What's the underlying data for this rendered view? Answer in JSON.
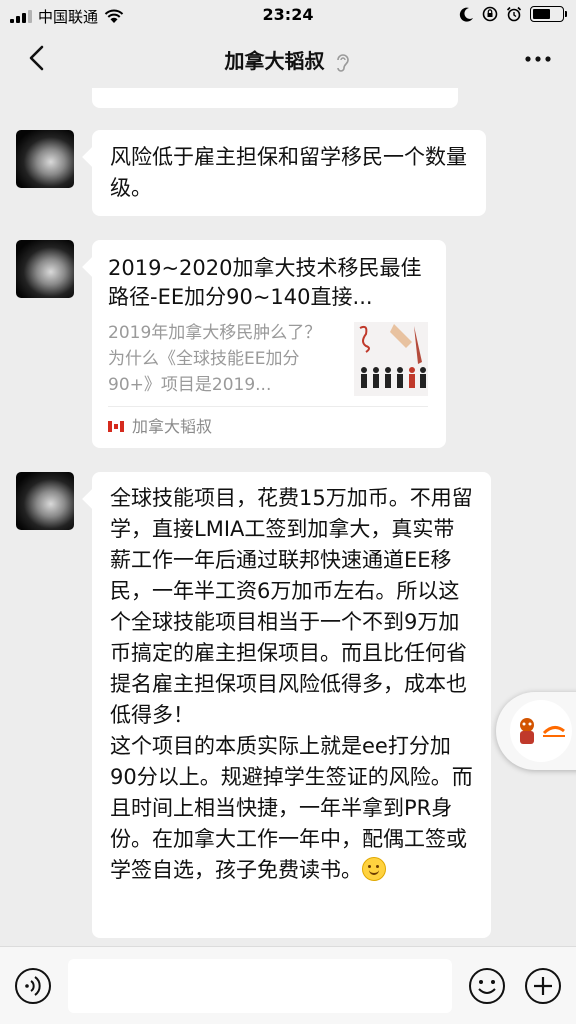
{
  "status_bar": {
    "carrier": "中国联通",
    "time": "23:24"
  },
  "nav": {
    "title": "加拿大韬叔",
    "back_icon": "chevron-left-icon",
    "ear_icon": "ear-icon",
    "more_icon": "more-dots-icon"
  },
  "messages": [
    {
      "type": "text",
      "text": "风险低于雇主担保和留学移民一个数量级。"
    },
    {
      "type": "link_card",
      "title": "2019~2020加拿大技术移民最佳路径-EE加分90~140直接...",
      "description": "2019年加拿大移民肿么了？为什么《全球技能EE加分90+》项目是2019...",
      "source": "加拿大韬叔",
      "source_icon": "canada-flag-icon"
    },
    {
      "type": "text",
      "text": "全球技能项目，花费15万加币。不用留学，直接LMIA工签到加拿大，真实带薪工作一年后通过联邦快速通道EE移民，一年半工资6万加币左右。所以这个全球技能项目相当于一个不到9万加币搞定的雇主担保项目。而且比任何省提名雇主担保项目风险低得多，成本也低得多！\n这个项目的本质实际上就是ee打分加90分以上。规避掉学生签证的风险。而且时间上相当快捷，一年半拿到PR身份。在加拿大工作一年中，配偶工签或学签自选，孩子免费读书。",
      "trailing_emoji": "smiling-face-icon"
    }
  ],
  "floating_widget": {
    "icon": "alibaba-mascot-icon"
  },
  "input_bar": {
    "voice_icon": "voice-icon",
    "emoji_icon": "emoji-icon",
    "plus_icon": "plus-icon",
    "placeholder": ""
  },
  "colors": {
    "background": "#ededed",
    "bubble": "#ffffff",
    "secondary_text": "#9a9a9a"
  }
}
